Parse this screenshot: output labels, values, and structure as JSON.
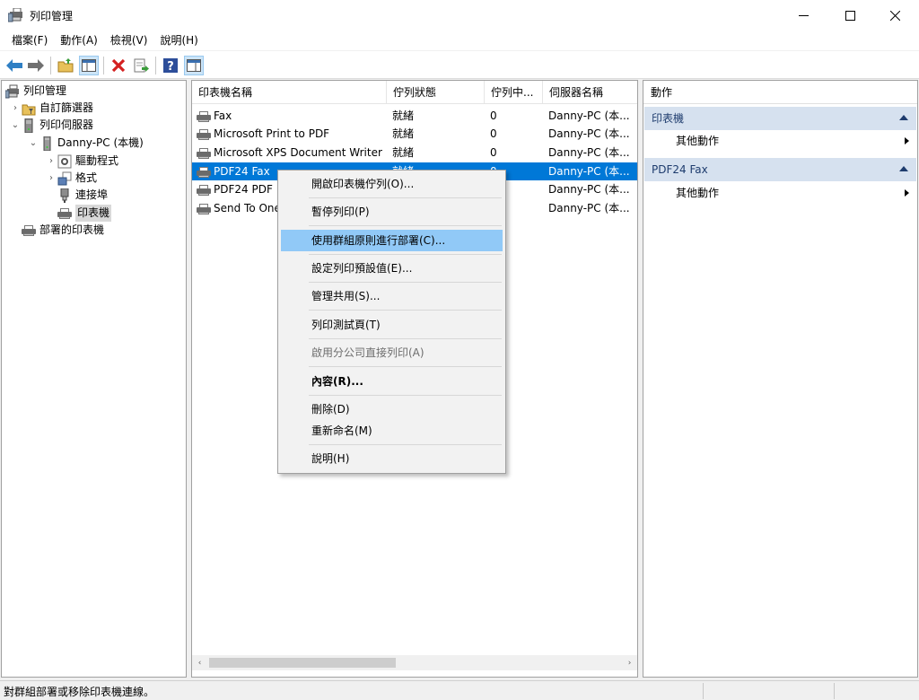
{
  "window": {
    "title": "列印管理",
    "minimize_glyph": "—",
    "maximize_glyph": "☐",
    "close_glyph": "✕"
  },
  "menubar": [
    "檔案(F)",
    "動作(A)",
    "檢視(V)",
    "說明(H)"
  ],
  "toolbar": {
    "icons": [
      "back-arrow-icon",
      "forward-arrow-icon",
      "up-folder-icon",
      "show-hide-tree-icon",
      "delete-icon",
      "export-list-icon",
      "help-icon",
      "show-hide-action-pane-icon"
    ]
  },
  "tree": {
    "items": [
      {
        "label": "列印管理",
        "level": 0,
        "twisty": "",
        "icon": "print-management-icon"
      },
      {
        "label": "自訂篩選器",
        "level": 1,
        "twisty": "›",
        "icon": "filter-folder-icon"
      },
      {
        "label": "列印伺服器",
        "level": 1,
        "twisty": "⌄",
        "icon": "server-icon"
      },
      {
        "label": "Danny-PC (本機)",
        "level": 2,
        "twisty": "⌄",
        "icon": "computer-icon"
      },
      {
        "label": "驅動程式",
        "level": 3,
        "twisty": "›",
        "icon": "drivers-icon"
      },
      {
        "label": "格式",
        "level": 3,
        "twisty": "›",
        "icon": "forms-icon"
      },
      {
        "label": "連接埠",
        "level": 3,
        "twisty": "",
        "icon": "port-icon"
      },
      {
        "label": "印表機",
        "level": 3,
        "twisty": "",
        "icon": "printer-icon",
        "selected": true
      },
      {
        "label": "部署的印表機",
        "level": 1,
        "twisty": "",
        "icon": "deployed-printer-icon"
      }
    ]
  },
  "list": {
    "columns": [
      "印表機名稱",
      "佇列狀態",
      "佇列中...",
      "伺服器名稱"
    ],
    "rows": [
      {
        "name": "Fax",
        "status": "就緒",
        "count": "0",
        "server": "Danny-PC (本..."
      },
      {
        "name": "Microsoft Print to PDF",
        "status": "就緒",
        "count": "0",
        "server": "Danny-PC (本..."
      },
      {
        "name": "Microsoft XPS Document Writer",
        "status": "就緒",
        "count": "0",
        "server": "Danny-PC (本..."
      },
      {
        "name": "PDF24 Fax",
        "status": "就緒",
        "count": "0",
        "server": "Danny-PC (本...",
        "selected": true
      },
      {
        "name": "PDF24 PDF",
        "status": "",
        "count": "",
        "server": "Danny-PC (本..."
      },
      {
        "name": "Send To One",
        "status": "",
        "count": "",
        "server": "Danny-PC (本..."
      }
    ],
    "scroll_left": "‹",
    "scroll_right": "›"
  },
  "actions": {
    "title": "動作",
    "sections": [
      {
        "title": "印表機",
        "item": "其他動作"
      },
      {
        "title": "PDF24 Fax",
        "item": "其他動作"
      }
    ]
  },
  "context_menu": [
    {
      "label": "開啟印表機佇列(O)...",
      "state": "normal"
    },
    {
      "label": "暫停列印(P)",
      "state": "normal"
    },
    {
      "label": "使用群組原則進行部署(C)...",
      "state": "hover"
    },
    {
      "label": "設定列印預設值(E)...",
      "state": "normal"
    },
    {
      "label": "管理共用(S)...",
      "state": "normal"
    },
    {
      "label": "列印測試頁(T)",
      "state": "normal"
    },
    {
      "label": "啟用分公司直接列印(A)",
      "state": "disabled"
    },
    {
      "label": "內容(R)...",
      "state": "bold"
    },
    {
      "label": "刪除(D)",
      "state": "normal"
    },
    {
      "label": "重新命名(M)",
      "state": "normal"
    },
    {
      "label": "說明(H)",
      "state": "normal"
    }
  ],
  "statusbar": {
    "text": "對群組部署或移除印表機連線。"
  },
  "colors": {
    "selection": "#0078d7",
    "menu_hover": "#91c9f7",
    "section_header": "#d6e1ef"
  }
}
